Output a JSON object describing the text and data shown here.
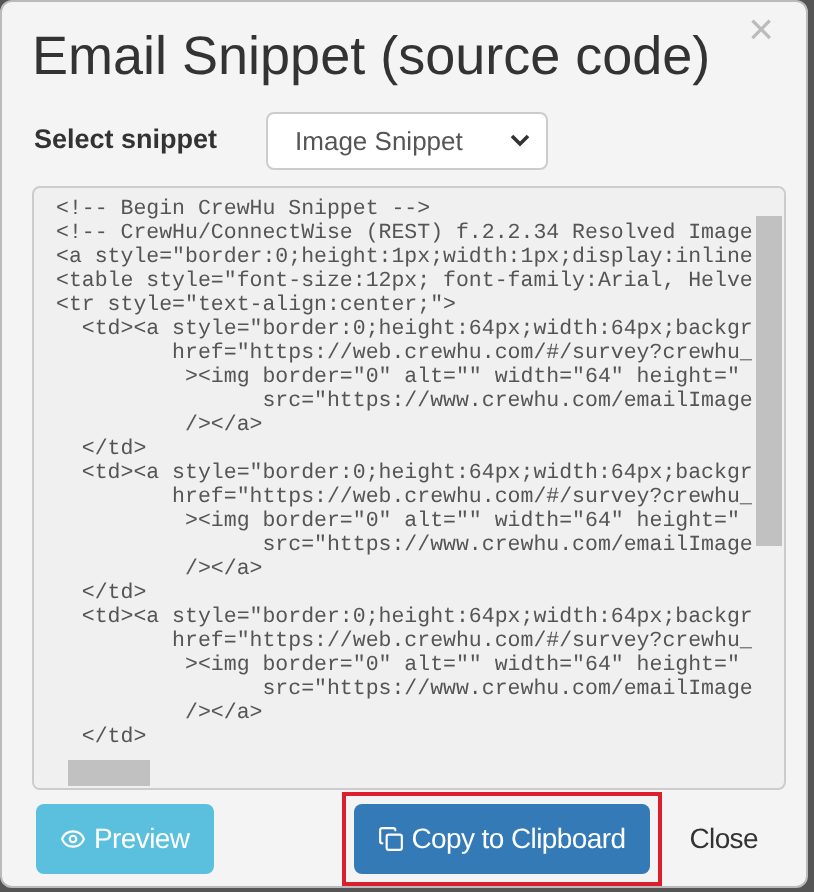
{
  "dialog": {
    "title": "Email Snippet (source code)",
    "close_glyph": "×"
  },
  "snippet_select": {
    "label": "Select snippet",
    "value": "Image Snippet"
  },
  "code_lines": [
    "<!-- Begin CrewHu Snippet -->",
    "<!-- CrewHu/ConnectWise (REST) f.2.2.34 Resolved Image",
    "<a style=\"border:0;height:1px;width:1px;display:inline",
    "<table style=\"font-size:12px; font-family:Arial, Helve",
    "<tr style=\"text-align:center;\">",
    "  <td><a style=\"border:0;height:64px;width:64px;backgr",
    "         href=\"https://web.crewhu.com/#/survey?crewhu_",
    "          ><img border=\"0\" alt=\"\" width=\"64\" height=\"",
    "                src=\"https://www.crewhu.com/emailImage",
    "          /></a>",
    "  </td>",
    "  <td><a style=\"border:0;height:64px;width:64px;backgr",
    "         href=\"https://web.crewhu.com/#/survey?crewhu_",
    "          ><img border=\"0\" alt=\"\" width=\"64\" height=\"",
    "                src=\"https://www.crewhu.com/emailImage",
    "          /></a>",
    "  </td>",
    "  <td><a style=\"border:0;height:64px;width:64px;backgr",
    "         href=\"https://web.crewhu.com/#/survey?crewhu_",
    "          ><img border=\"0\" alt=\"\" width=\"64\" height=\"",
    "                src=\"https://www.crewhu.com/emailImage",
    "          /></a>",
    "  </td>"
  ],
  "buttons": [
    {
      "kind": "preview",
      "label": "Preview",
      "highlighted": false
    },
    {
      "kind": "copy",
      "label": "Copy to Clipboard",
      "highlighted": true
    },
    {
      "kind": "close",
      "label": "Close",
      "highlighted": false
    }
  ]
}
